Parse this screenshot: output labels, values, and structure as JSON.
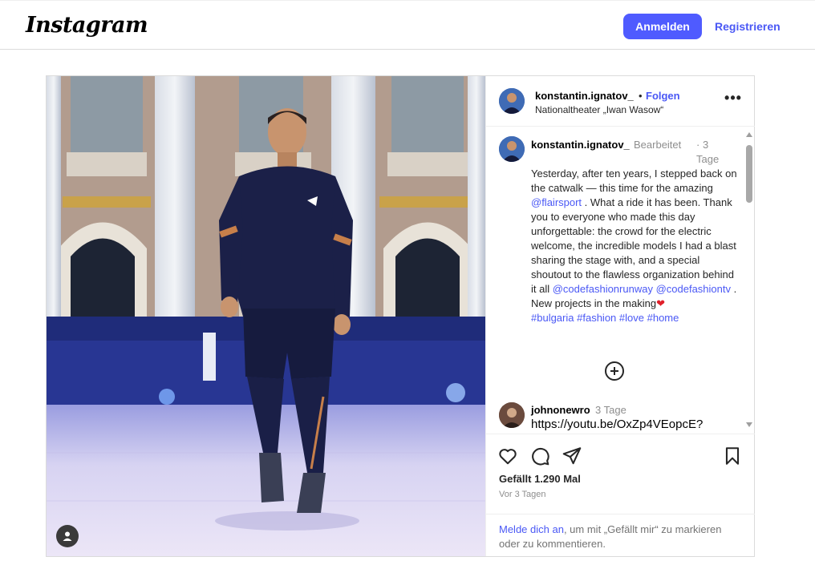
{
  "header": {
    "logo_text": "Instagram",
    "login_label": "Anmelden",
    "register_label": "Registrieren"
  },
  "post": {
    "username": "konstantin.ignatov_",
    "dot": "•",
    "follow_label": "Folgen",
    "location": "Nationaltheater „Iwan Wasow“",
    "more_label": "•••",
    "caption": {
      "username": "konstantin.ignatov_",
      "edited": "Bearbeitet",
      "time": "3 Tage",
      "text_1": "Yesterday, after ten years, I stepped back on the catwalk — this time for the amazing ",
      "mention_1": "@flairsport",
      "text_2": " . What a ride it has been. Thank you to everyone who made this day unforgettable: the crowd for the electric welcome, the incredible models I had a blast sharing the stage with, and a special shoutout to the flawless organization behind it all ",
      "mention_2": "@codefashionrunway",
      "text_3": " ",
      "mention_3": "@codefashiontv",
      "text_4": " . New projects in the making",
      "heart": "❤",
      "hashtag_1": "#bulgaria",
      "hashtag_2": "#fashion",
      "hashtag_3": "#love",
      "hashtag_4": "#home"
    },
    "comments": [
      {
        "username": "johnonewro",
        "time": "3 Tage",
        "text": "https://youtu.be/OxZp4VEopcE?"
      }
    ],
    "likes": "Gefällt 1.290 Mal",
    "date": "Vor 3 Tagen",
    "login_prompt": {
      "link": "Melde dich an",
      "text": ", um mit „Gefällt mir“ zu markieren oder zu kommentieren."
    }
  },
  "colors": {
    "accent": "#4f5bff",
    "link": "#4a58f5",
    "muted": "#8e8e8e",
    "border": "#dbdbdb",
    "heart": "#e0202a"
  },
  "icons": {
    "like": "heart-outline-icon",
    "comment": "comment-bubble-icon",
    "share": "paper-plane-icon",
    "save": "bookmark-icon",
    "load_more": "plus-circle-icon",
    "media_user": "user-tag-icon"
  }
}
